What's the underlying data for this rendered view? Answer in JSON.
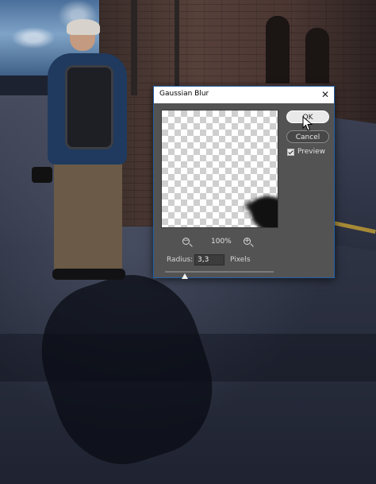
{
  "dialog": {
    "title": "Gaussian Blur",
    "close_glyph": "✕",
    "ok_label": "OK",
    "cancel_label": "Cancel",
    "preview_label": "Preview",
    "preview_checked": true,
    "zoom_percent": "100%",
    "zoom_out_icon": "zoom-out-icon",
    "zoom_in_icon": "zoom-in-icon",
    "radius_label": "Radius:",
    "radius_value": "3,3",
    "radius_unit": "Pixels"
  },
  "colors": {
    "dialog_bg": "#535353",
    "dialog_border": "#1f5fa8",
    "ok_button": "#e9e9e9"
  }
}
